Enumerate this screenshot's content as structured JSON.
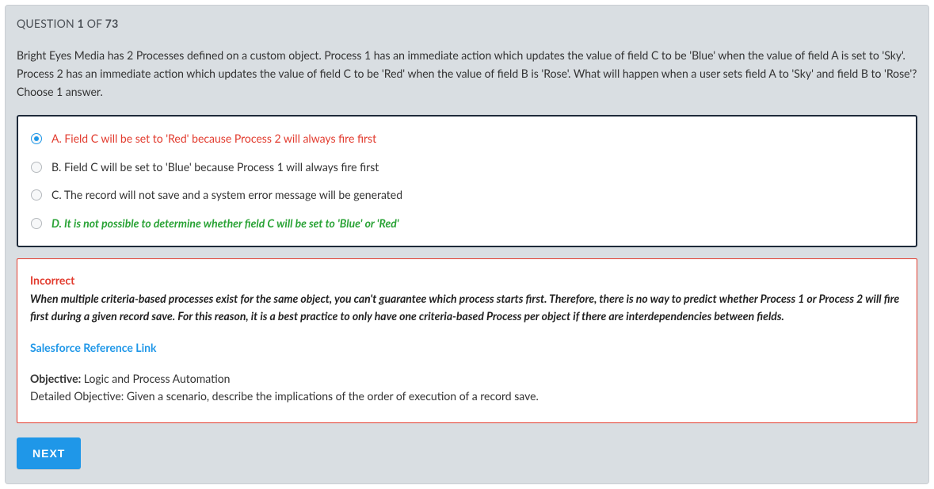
{
  "header": {
    "prefix": "QUESTION ",
    "current": "1",
    "mid": " OF ",
    "total": "73"
  },
  "question_text": "Bright Eyes Media has 2 Processes defined on a custom object. Process 1 has an immediate action which updates the value of field C to be 'Blue' when the value of field A is set to 'Sky'. Process 2 has an immediate action which updates the value of field C to be 'Red' when the value of field B is 'Rose'. What will happen when a user sets field A to 'Sky' and field B to 'Rose'? Choose 1 answer.",
  "options": {
    "a": "A. Field C will be set to 'Red' because Process 2 will always fire first",
    "b": "B. Field C will be set to 'Blue' because Process 1 will always fire first",
    "c": "C. The record will not save and a system error message will be generated",
    "d": "D. It is not possible to determine whether field C will be set to 'Blue' or 'Red'"
  },
  "feedback": {
    "status": "Incorrect",
    "explanation": "When multiple criteria-based processes exist for the same object, you can't guarantee which process starts first. Therefore, there is no way to predict whether Process 1 or Process 2 will fire first during a given record save. For this reason, it is a best practice to only have one criteria-based Process per object if there are interdependencies between fields.",
    "link_label": "Salesforce Reference Link",
    "objective_label": "Objective:",
    "objective_value": " Logic and Process Automation",
    "detailed_label": "Detailed Objective:",
    "detailed_value": " Given a scenario, describe the implications of the order of execution of a record save."
  },
  "buttons": {
    "next": "NEXT"
  }
}
